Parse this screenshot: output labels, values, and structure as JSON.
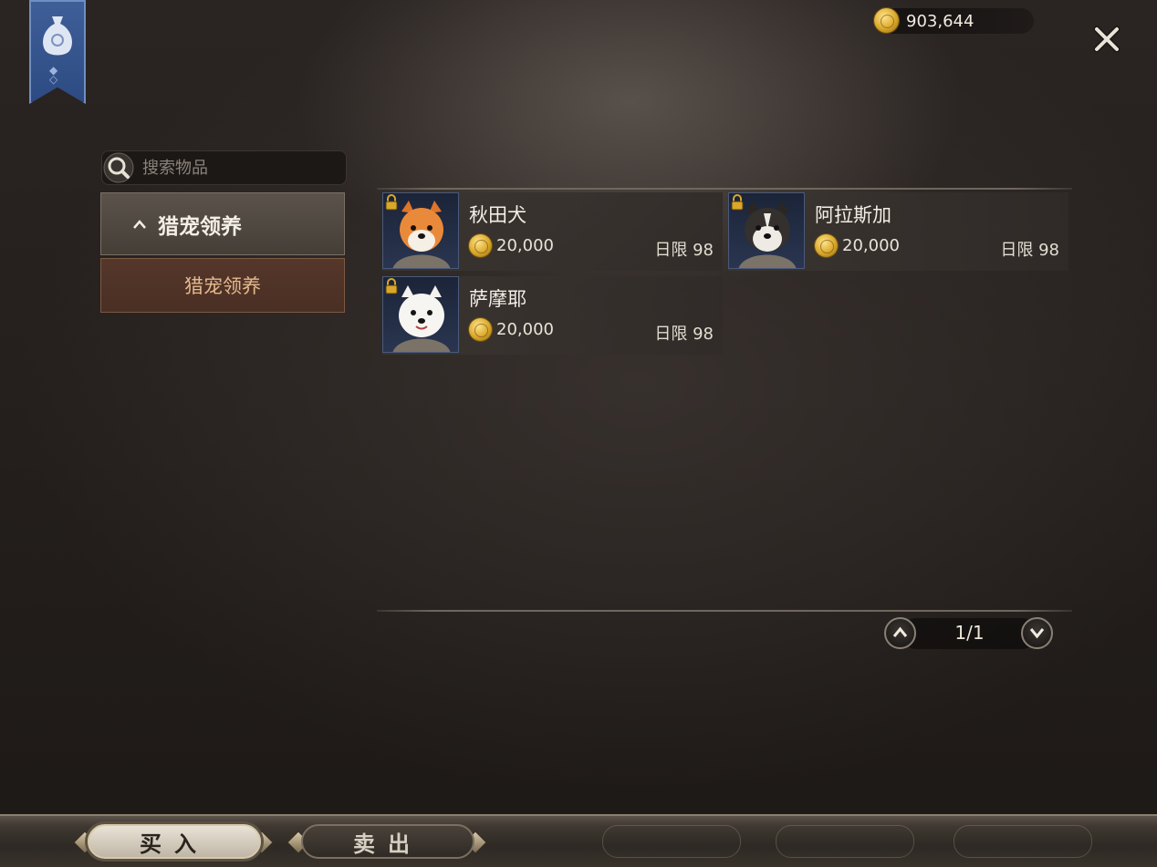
{
  "currency": {
    "amount": "903,644",
    "icon": "gold-coin-icon"
  },
  "search": {
    "placeholder": "搜索物品"
  },
  "category": {
    "header_label": "猎宠领养",
    "items": [
      {
        "label": "猎宠领养",
        "selected": true
      }
    ]
  },
  "items": [
    {
      "name": "秋田犬",
      "price": "20,000",
      "limit": "日限 98",
      "locked": true,
      "portrait": "akita-dog-portrait"
    },
    {
      "name": "阿拉斯加",
      "price": "20,000",
      "limit": "日限 98",
      "locked": true,
      "portrait": "alaskan-dog-portrait"
    },
    {
      "name": "萨摩耶",
      "price": "20,000",
      "limit": "日限 98",
      "locked": true,
      "portrait": "samoyed-dog-portrait"
    }
  ],
  "pagination": {
    "page": "1/1"
  },
  "tabs": {
    "buy_label": "买入",
    "sell_label": "卖出",
    "active": "buy"
  },
  "colors": {
    "accent_gold": "#d9a72a",
    "selected_category": "#4a2f24",
    "banner_blue": "#2d4a82"
  }
}
